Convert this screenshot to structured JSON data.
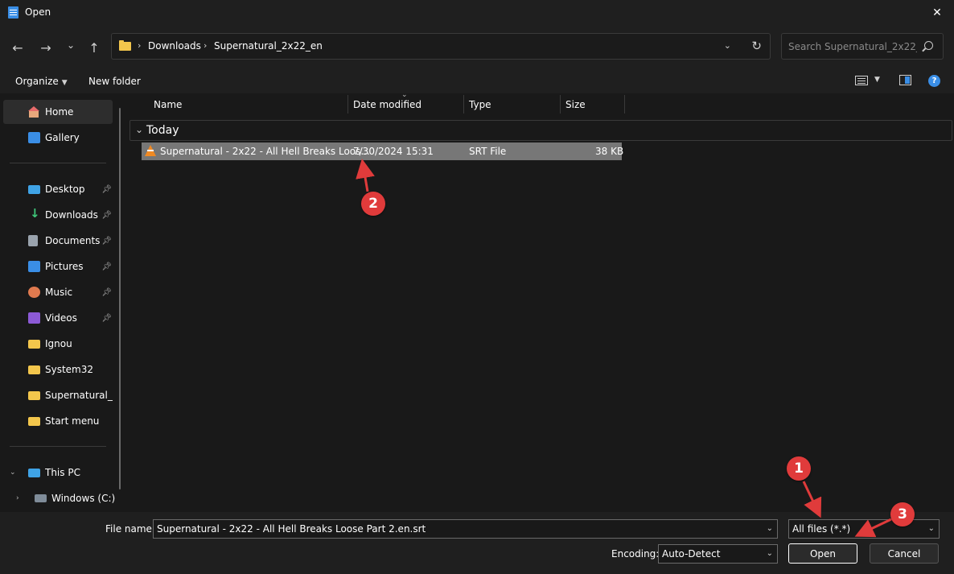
{
  "window": {
    "title": "Open",
    "close_glyph": "✕"
  },
  "nav": {
    "back_glyph": "←",
    "forward_glyph": "→",
    "recent_glyph": "⌄",
    "up_glyph": "↑",
    "breadcrumbs": [
      "Downloads",
      "Supernatural_2x22_en"
    ],
    "search_placeholder": "Search Supernatural_2x22_en"
  },
  "commands": {
    "organize": "Organize",
    "new_folder": "New folder",
    "help": "?"
  },
  "sidebar": {
    "items": [
      {
        "label": "Home",
        "icon": "home-icon",
        "pinned": false
      },
      {
        "label": "Gallery",
        "icon": "gallery-icon",
        "pinned": false
      },
      {
        "label": "Desktop",
        "icon": "desktop-icon",
        "pinned": true
      },
      {
        "label": "Downloads",
        "icon": "downloads-icon",
        "pinned": true
      },
      {
        "label": "Documents",
        "icon": "documents-icon",
        "pinned": true
      },
      {
        "label": "Pictures",
        "icon": "pictures-icon",
        "pinned": true
      },
      {
        "label": "Music",
        "icon": "music-icon",
        "pinned": true
      },
      {
        "label": "Videos",
        "icon": "videos-icon",
        "pinned": true
      },
      {
        "label": "Ignou",
        "icon": "folder-icon",
        "pinned": false
      },
      {
        "label": "System32",
        "icon": "folder-icon",
        "pinned": false
      },
      {
        "label": "Supernatural_2x",
        "icon": "folder-icon",
        "pinned": false
      },
      {
        "label": "Start menu",
        "icon": "folder-icon",
        "pinned": false
      },
      {
        "label": "This PC",
        "icon": "pc-icon",
        "pinned": false
      },
      {
        "label": "Windows (C:)",
        "icon": "drive-icon",
        "pinned": false
      }
    ]
  },
  "columns": {
    "name": "Name",
    "date": "Date modified",
    "type": "Type",
    "size": "Size"
  },
  "group": {
    "label": "Today"
  },
  "file": {
    "name": "Supernatural - 2x22 - All Hell Breaks Loos...",
    "date": "7/30/2024 15:31",
    "type": "SRT File",
    "size": "38 KB"
  },
  "footer": {
    "file_name_label": "File name:",
    "file_name_value": "Supernatural - 2x22 - All Hell Breaks Loose  Part 2.en.srt",
    "file_type_value": "All files  (*.*)",
    "encoding_label": "Encoding:",
    "encoding_value": "Auto-Detect",
    "open_label": "Open",
    "cancel_label": "Cancel"
  },
  "annotations": [
    "1",
    "2",
    "3"
  ],
  "colors": {
    "accent": "#3a8ee6",
    "annotation": "#e03b3b",
    "selection": "#777777"
  }
}
